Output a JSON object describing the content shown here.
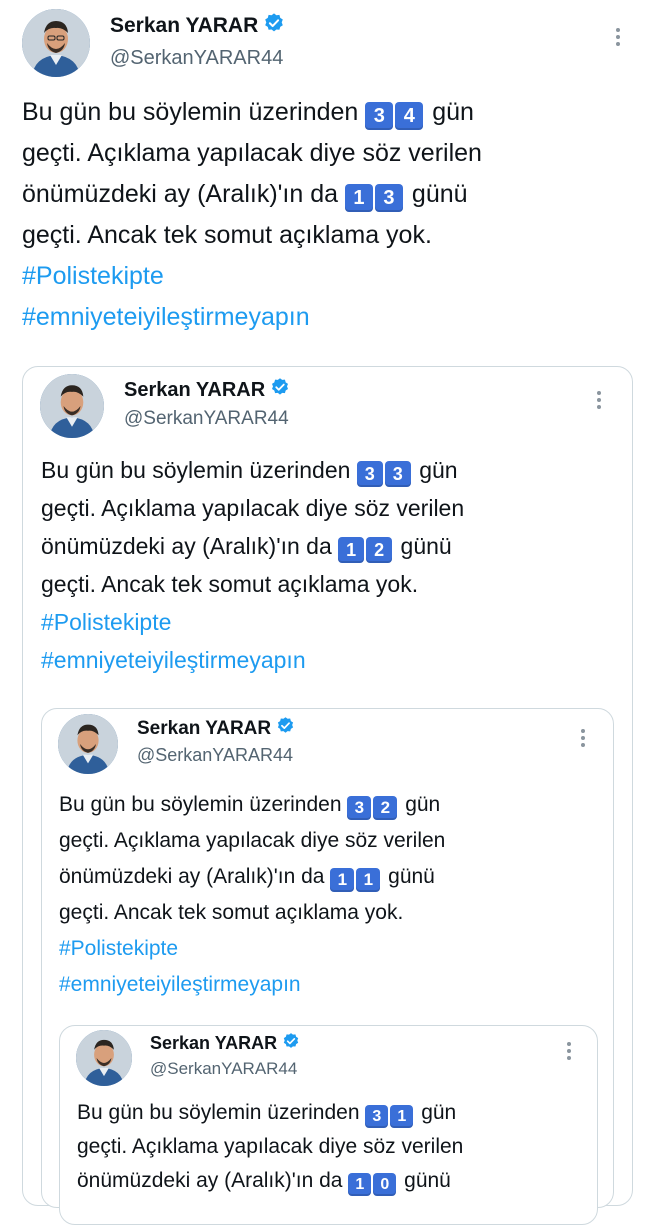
{
  "tweet": {
    "author_name": "Serkan YARAR",
    "author_handle": "@SerkanYARAR44",
    "line1_pre": "Bu gün bu söylemin üzerinden ",
    "line1_keys": [
      "3",
      "4"
    ],
    "line1_post": " gün",
    "line2": "geçti. Açıklama yapılacak diye söz verilen",
    "line3_pre": "önümüzdeki ay (Aralık)'ın da ",
    "line3_keys": [
      "1",
      "3"
    ],
    "line3_post": " günü",
    "line4": "geçti. Ancak tek somut açıklama yok.",
    "hashtags": [
      "#Polistekipte",
      "#emniyeteiyileştirmeyapın"
    ]
  },
  "quote1": {
    "author_name": "Serkan YARAR",
    "author_handle": "@SerkanYARAR44",
    "line1_pre": "Bu gün bu söylemin üzerinden ",
    "line1_keys": [
      "3",
      "3"
    ],
    "line1_post": " gün",
    "line2": "geçti. Açıklama yapılacak diye söz verilen",
    "line3_pre": "önümüzdeki ay (Aralık)'ın da ",
    "line3_keys": [
      "1",
      "2"
    ],
    "line3_post": " günü",
    "line4": "geçti. Ancak tek somut açıklama yok.",
    "hashtags": [
      "#Polistekipte",
      "#emniyeteiyileştirmeyapın"
    ]
  },
  "quote2": {
    "author_name": "Serkan YARAR",
    "author_handle": "@SerkanYARAR44",
    "line1_pre": "Bu gün bu söylemin üzerinden ",
    "line1_keys": [
      "3",
      "2"
    ],
    "line1_post": " gün",
    "line2": "geçti. Açıklama yapılacak diye söz verilen",
    "line3_pre": "önümüzdeki ay (Aralık)'ın da ",
    "line3_keys": [
      "1",
      "1"
    ],
    "line3_post": " günü",
    "line4": "geçti. Ancak tek somut açıklama yok.",
    "hashtags": [
      "#Polistekipte",
      "#emniyeteiyileştirmeyapın"
    ]
  },
  "quote3": {
    "author_name": "Serkan YARAR",
    "author_handle": "@SerkanYARAR44",
    "line1_pre": "Bu gün bu söylemin üzerinden ",
    "line1_keys": [
      "3",
      "1"
    ],
    "line1_post": " gün",
    "line2": "geçti. Açıklama yapılacak diye söz verilen",
    "line3_pre": "önümüzdeki ay (Aralık)'ın da ",
    "line3_keys": [
      "1",
      "0"
    ],
    "line3_post": " günü"
  },
  "icons": {
    "verified": "verified-badge-icon",
    "more": "more-options-icon"
  },
  "colors": {
    "hashtag": "#1d9bf0",
    "verified": "#1d9bf0",
    "keycap": "#3a6fd8",
    "border": "#cfd9de",
    "handle": "#536471"
  }
}
